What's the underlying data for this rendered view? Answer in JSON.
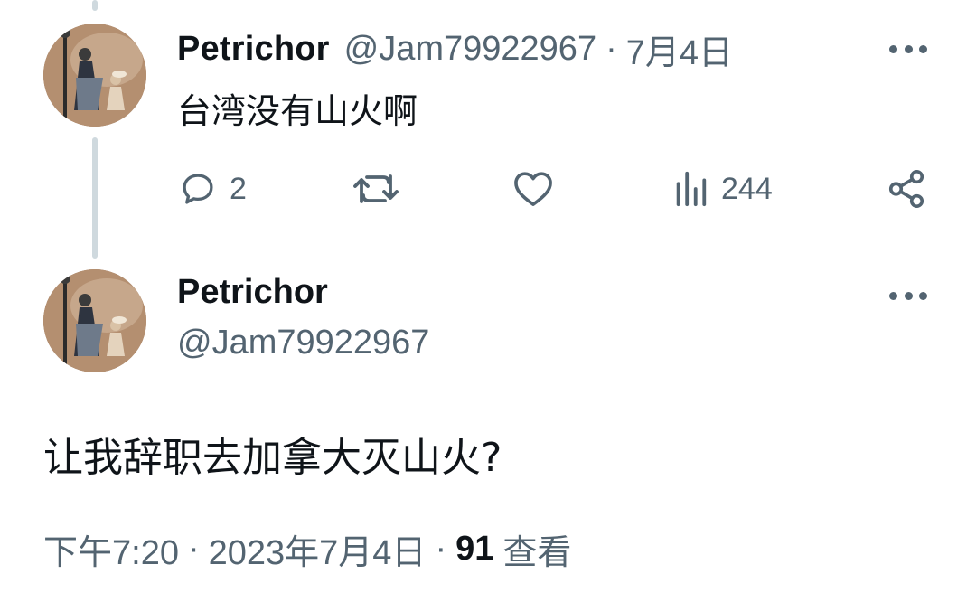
{
  "tweet1": {
    "display_name": "Petrichor",
    "handle": "@Jam79922967",
    "separator": "·",
    "date": "7月4日",
    "text": "台湾没有山火啊",
    "actions": {
      "reply_count": "2",
      "retweet_count": "",
      "like_count": "",
      "views_count": "244"
    },
    "icons": [
      "reply-icon",
      "retweet-icon",
      "like-icon",
      "views-icon",
      "share-icon",
      "more-icon"
    ]
  },
  "tweet2": {
    "display_name": "Petrichor",
    "handle": "@Jam79922967",
    "text": "让我辞职去加拿大灭山火?",
    "time": "下午7:20",
    "separator": "·",
    "date": "2023年7月4日",
    "views_count": "91",
    "views_label": "查看"
  },
  "colors": {
    "text_primary": "#0f1419",
    "text_secondary": "#536471",
    "thread_line": "#cfd9de",
    "background": "#ffffff"
  }
}
